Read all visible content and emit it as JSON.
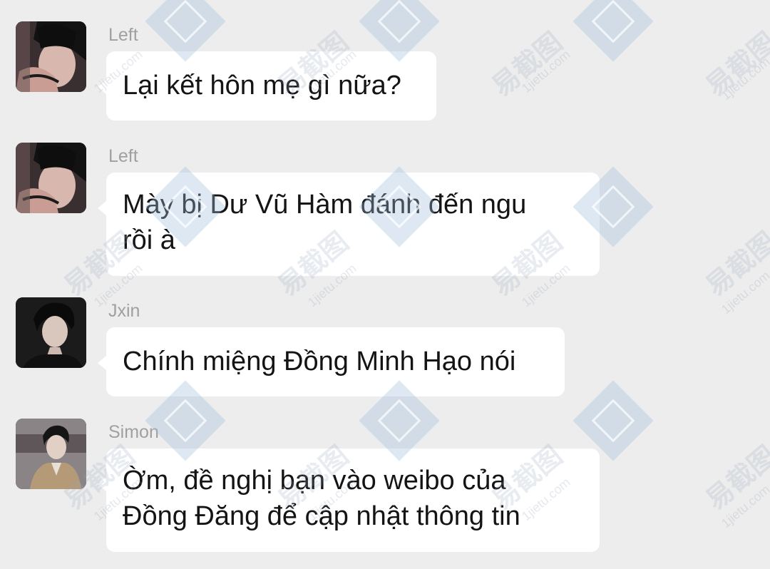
{
  "colors": {
    "background": "#ededed",
    "bubble": "#ffffff",
    "sender_name": "#a0a0a0",
    "message_text": "#141414"
  },
  "messages": [
    {
      "sender": "Left",
      "avatar_icon": "user-avatar-photo-icon",
      "lines": [
        "Lại kết hôn mẹ gì nữa?"
      ]
    },
    {
      "sender": "Left",
      "avatar_icon": "user-avatar-photo-icon",
      "lines": [
        "Mày bị Dư Vũ Hàm đánh đến ngu",
        "rồi à"
      ]
    },
    {
      "sender": "Jxin",
      "avatar_icon": "user-avatar-photo-icon",
      "lines": [
        "Chính miệng Đồng Minh Hạo nói"
      ]
    },
    {
      "sender": "Simon",
      "avatar_icon": "user-avatar-photo-icon",
      "lines": [
        "Ờm, đề nghị bạn vào weibo của",
        "Đồng Đăng để cập nhật thông tin"
      ]
    }
  ],
  "watermark": {
    "text": "易截图",
    "subtext": "1jietu.com"
  }
}
